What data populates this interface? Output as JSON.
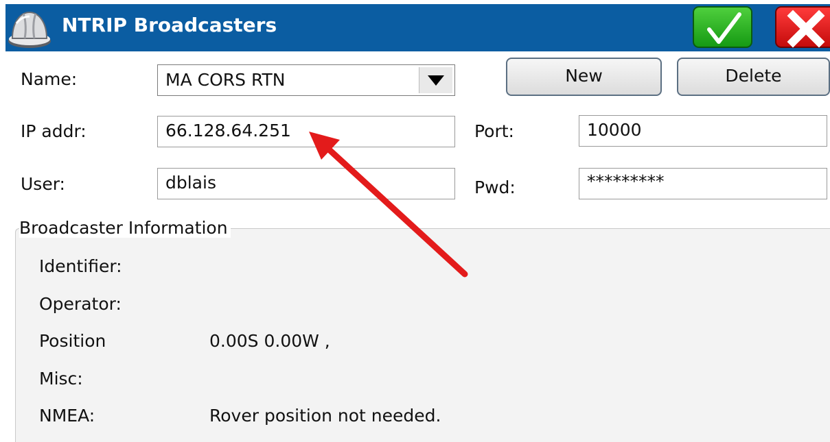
{
  "titlebar": {
    "title": "NTRIP Broadcasters",
    "logo_icon": "hard-hat-icon",
    "ok_icon": "checkmark-icon",
    "cancel_icon": "close-x-icon",
    "bar_color": "#0b5da2"
  },
  "form": {
    "name_label": "Name:",
    "name_value": "MA CORS RTN",
    "new_label": "New",
    "delete_label": "Delete",
    "ip_label": "IP addr:",
    "ip_value": "66.128.64.251",
    "port_label": "Port:",
    "port_value": "10000",
    "user_label": "User:",
    "user_value": "dblais",
    "pwd_label": "Pwd:",
    "pwd_value": "*********"
  },
  "info": {
    "title": "Broadcaster Information",
    "identifier_label": "Identifier:",
    "identifier_value": "",
    "operator_label": "Operator:",
    "operator_value": "",
    "position_label": "Position",
    "position_value": "0.00S 0.00W ,",
    "misc_label": "Misc:",
    "misc_value": "",
    "nmea_label": "NMEA:",
    "nmea_value": "Rover position not needed."
  },
  "annotation": {
    "arrow_icon": "red-arrow-icon",
    "arrow_color": "#e31b1b"
  }
}
